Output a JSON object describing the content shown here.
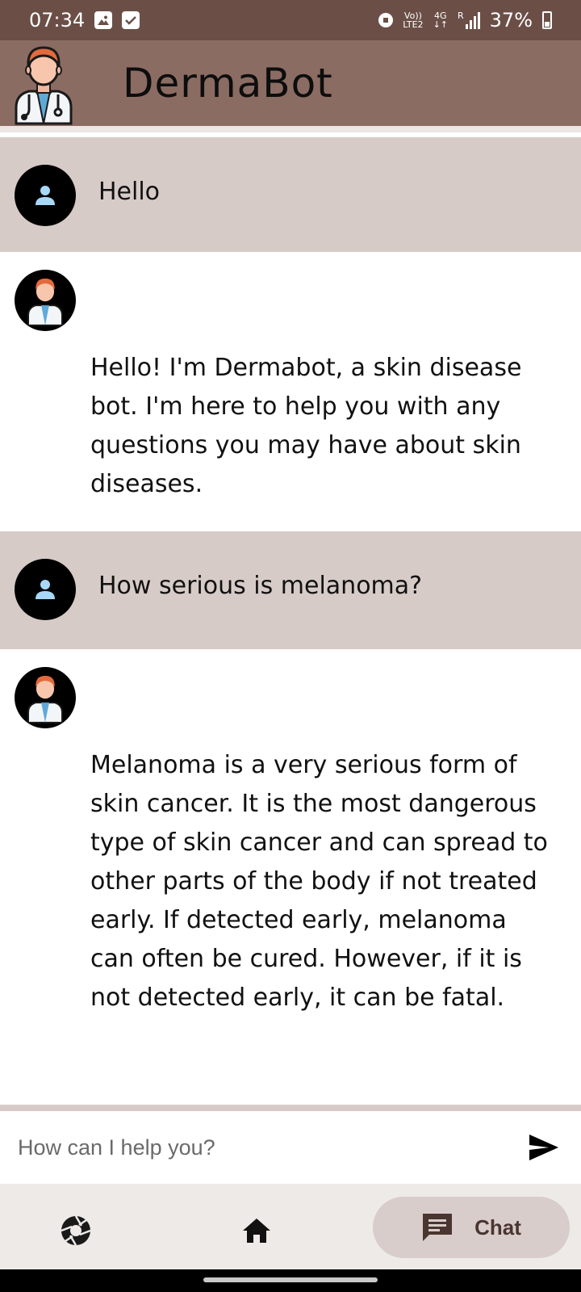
{
  "status_bar": {
    "time": "07:34",
    "network_top": "Vo))",
    "network_bottom": "LTE2",
    "signal_type": "4G",
    "roaming": "R",
    "battery": "37%"
  },
  "app_bar": {
    "title": "DermaBot",
    "logo_icon": "doctor-avatar-icon"
  },
  "messages": [
    {
      "role": "user",
      "text": "Hello"
    },
    {
      "role": "bot",
      "text": "Hello! I'm Dermabot, a skin disease bot. I'm here to help you with any questions you may have about skin diseases."
    },
    {
      "role": "user",
      "text": "How serious is melanoma?"
    },
    {
      "role": "bot",
      "text": "Melanoma is a very serious form of skin cancer. It is the most dangerous type of skin cancer and can spread to other parts of the body if not treated early. If detected early, melanoma can often be cured. However, if it is not detected early, it can be fatal."
    }
  ],
  "input": {
    "placeholder": "How can I help you?",
    "value": ""
  },
  "bottom_nav": {
    "items": [
      {
        "icon": "camera-aperture-icon",
        "label": ""
      },
      {
        "icon": "home-icon",
        "label": ""
      },
      {
        "icon": "chat-icon",
        "label": "Chat",
        "selected": true
      }
    ]
  },
  "colors": {
    "status_bar": "#6b4f47",
    "app_bar": "#8b6c63",
    "user_bubble": "#d7cbc8",
    "nav_selected": "#d8cdca"
  }
}
